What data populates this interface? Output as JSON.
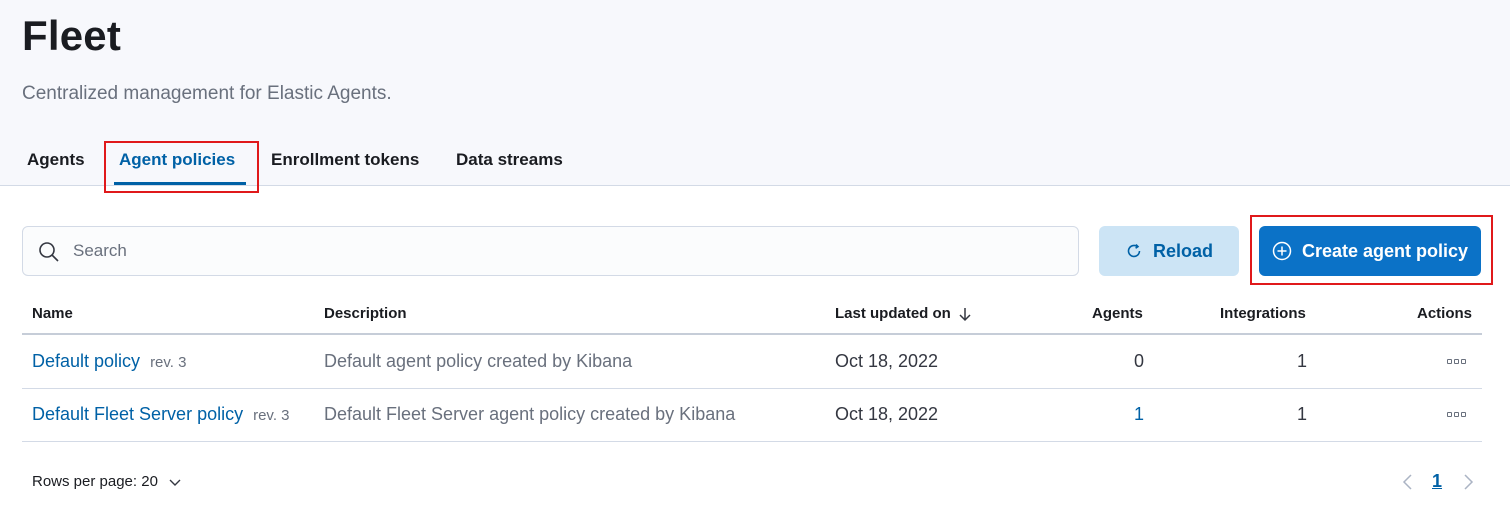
{
  "header": {
    "title": "Fleet",
    "subtitle": "Centralized management for Elastic Agents."
  },
  "tabs": [
    {
      "label": "Agents",
      "active": false
    },
    {
      "label": "Agent policies",
      "active": true
    },
    {
      "label": "Enrollment tokens",
      "active": false
    },
    {
      "label": "Data streams",
      "active": false
    }
  ],
  "search": {
    "placeholder": "Search",
    "value": ""
  },
  "toolbar": {
    "reload_label": "Reload",
    "create_label": "Create agent policy"
  },
  "table": {
    "columns": [
      "Name",
      "Description",
      "Last updated on",
      "Agents",
      "Integrations",
      "Actions"
    ],
    "sort_icon": "arrow-down-icon",
    "rows": [
      {
        "name": "Default policy",
        "rev": "rev. 3",
        "description": "Default agent policy created by Kibana",
        "updated": "Oct 18, 2022",
        "agents": "0",
        "integrations": "1"
      },
      {
        "name": "Default Fleet Server policy",
        "rev": "rev. 3",
        "description": "Default Fleet Server agent policy created by Kibana",
        "updated": "Oct 18, 2022",
        "agents": "1",
        "integrations": "1"
      }
    ]
  },
  "pagination": {
    "rows_per_page": "Rows per page: 20",
    "current_page": "1"
  },
  "colors": {
    "accent": "#0061a6",
    "primary_button": "#0b72c7",
    "highlight": "#e0191b"
  }
}
